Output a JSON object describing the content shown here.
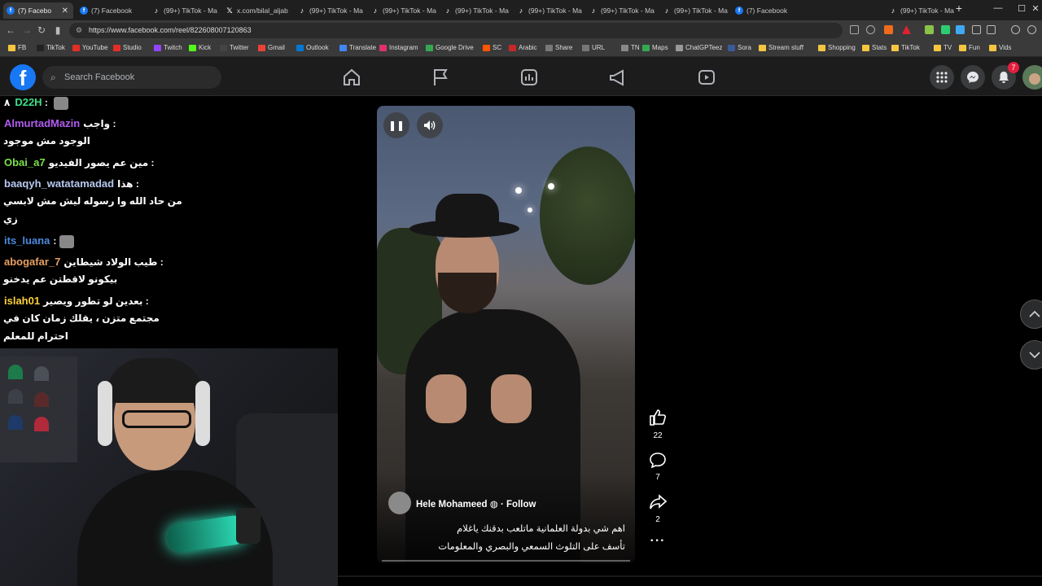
{
  "browser": {
    "tabs": [
      {
        "label": "(7) Facebo",
        "icon": "facebook-icon",
        "active": true
      },
      {
        "label": "(7) Facebook",
        "icon": "facebook-icon"
      },
      {
        "label": "(99+) TikTok - Ma",
        "icon": "tiktok-icon"
      },
      {
        "label": "x.com/bilal_aljab",
        "icon": "x-icon"
      },
      {
        "label": "(99+) TikTok - Ma",
        "icon": "tiktok-icon"
      },
      {
        "label": "(99+) TikTok - Ma",
        "icon": "tiktok-icon"
      },
      {
        "label": "(99+) TikTok - Ma",
        "icon": "tiktok-icon"
      },
      {
        "label": "(99+) TikTok - Ma",
        "icon": "tiktok-icon"
      },
      {
        "label": "(99+) TikTok - Ma",
        "icon": "tiktok-icon"
      },
      {
        "label": "(99+) TikTok - Ma",
        "icon": "tiktok-icon"
      },
      {
        "label": "(7) Facebook",
        "icon": "facebook-icon"
      },
      {
        "label": "(99+) TikTok - Ma",
        "icon": "tiktok-icon"
      }
    ],
    "url": "https://www.facebook.com/reel/822608007120863",
    "bookmarks": [
      "FB",
      "TikTok",
      "YouTube",
      "Studio",
      "Twitch",
      "Kick",
      "Twitter",
      "Gmail",
      "Outlook",
      "Translate",
      "Instagram",
      "Google Drive",
      "SC",
      "Arabic",
      "Share",
      "URL",
      "TN",
      "Maps",
      "ChatGPTeez",
      "Sora",
      "Stream stuff",
      "Shopping",
      "Stats",
      "TikTok",
      "TV",
      "Fun",
      "Vids"
    ]
  },
  "facebook": {
    "search_placeholder": "Search Facebook",
    "notification_count": "7"
  },
  "chat": [
    {
      "prefix": "٨",
      "user": "D22H",
      "msg": "",
      "emote": true,
      "color": "#3ee08a"
    },
    {
      "user": "AlmurtadMazin",
      "msg": "واجب :",
      "msg2": "الوجود مش موجود",
      "color": "#b25cf0"
    },
    {
      "user": "Obai_a7",
      "msg": "مين عم يصور الفيديو :",
      "color": "#7be04a"
    },
    {
      "user": "baaqyh_watatamadad",
      "msg": "هذا :",
      "msg2": "من حاد الله وا رسوله ليش مش لابسي",
      "msg3": "زي",
      "color": "#b7c8f0"
    },
    {
      "user": "its_luana",
      "msg": ":",
      "emote": true,
      "color": "#4a8ae0"
    },
    {
      "user": "abogafar_7",
      "msg": "طيب الولاد شيطاين :",
      "msg2": "بيكونو لاقطتن عم يدخنو",
      "color": "#e8a060"
    },
    {
      "user": "islah01",
      "msg": "بعدين لو تطور ويصير :",
      "msg2": "مجتمع متزن ، يقلك زمان كان في",
      "msg3": "احترام للمعلم",
      "color": "#ffd23a"
    }
  ],
  "reel": {
    "author": "Hele Mohameed",
    "follow": "Follow",
    "caption_line1": "اهم شي بدولة العلمانية ماتلعب بدقنك ياغلام",
    "caption_line2": "تأسف على التلوث السمعي والبصري والمعلومات",
    "likes": "22",
    "comments": "7",
    "shares": "2"
  }
}
